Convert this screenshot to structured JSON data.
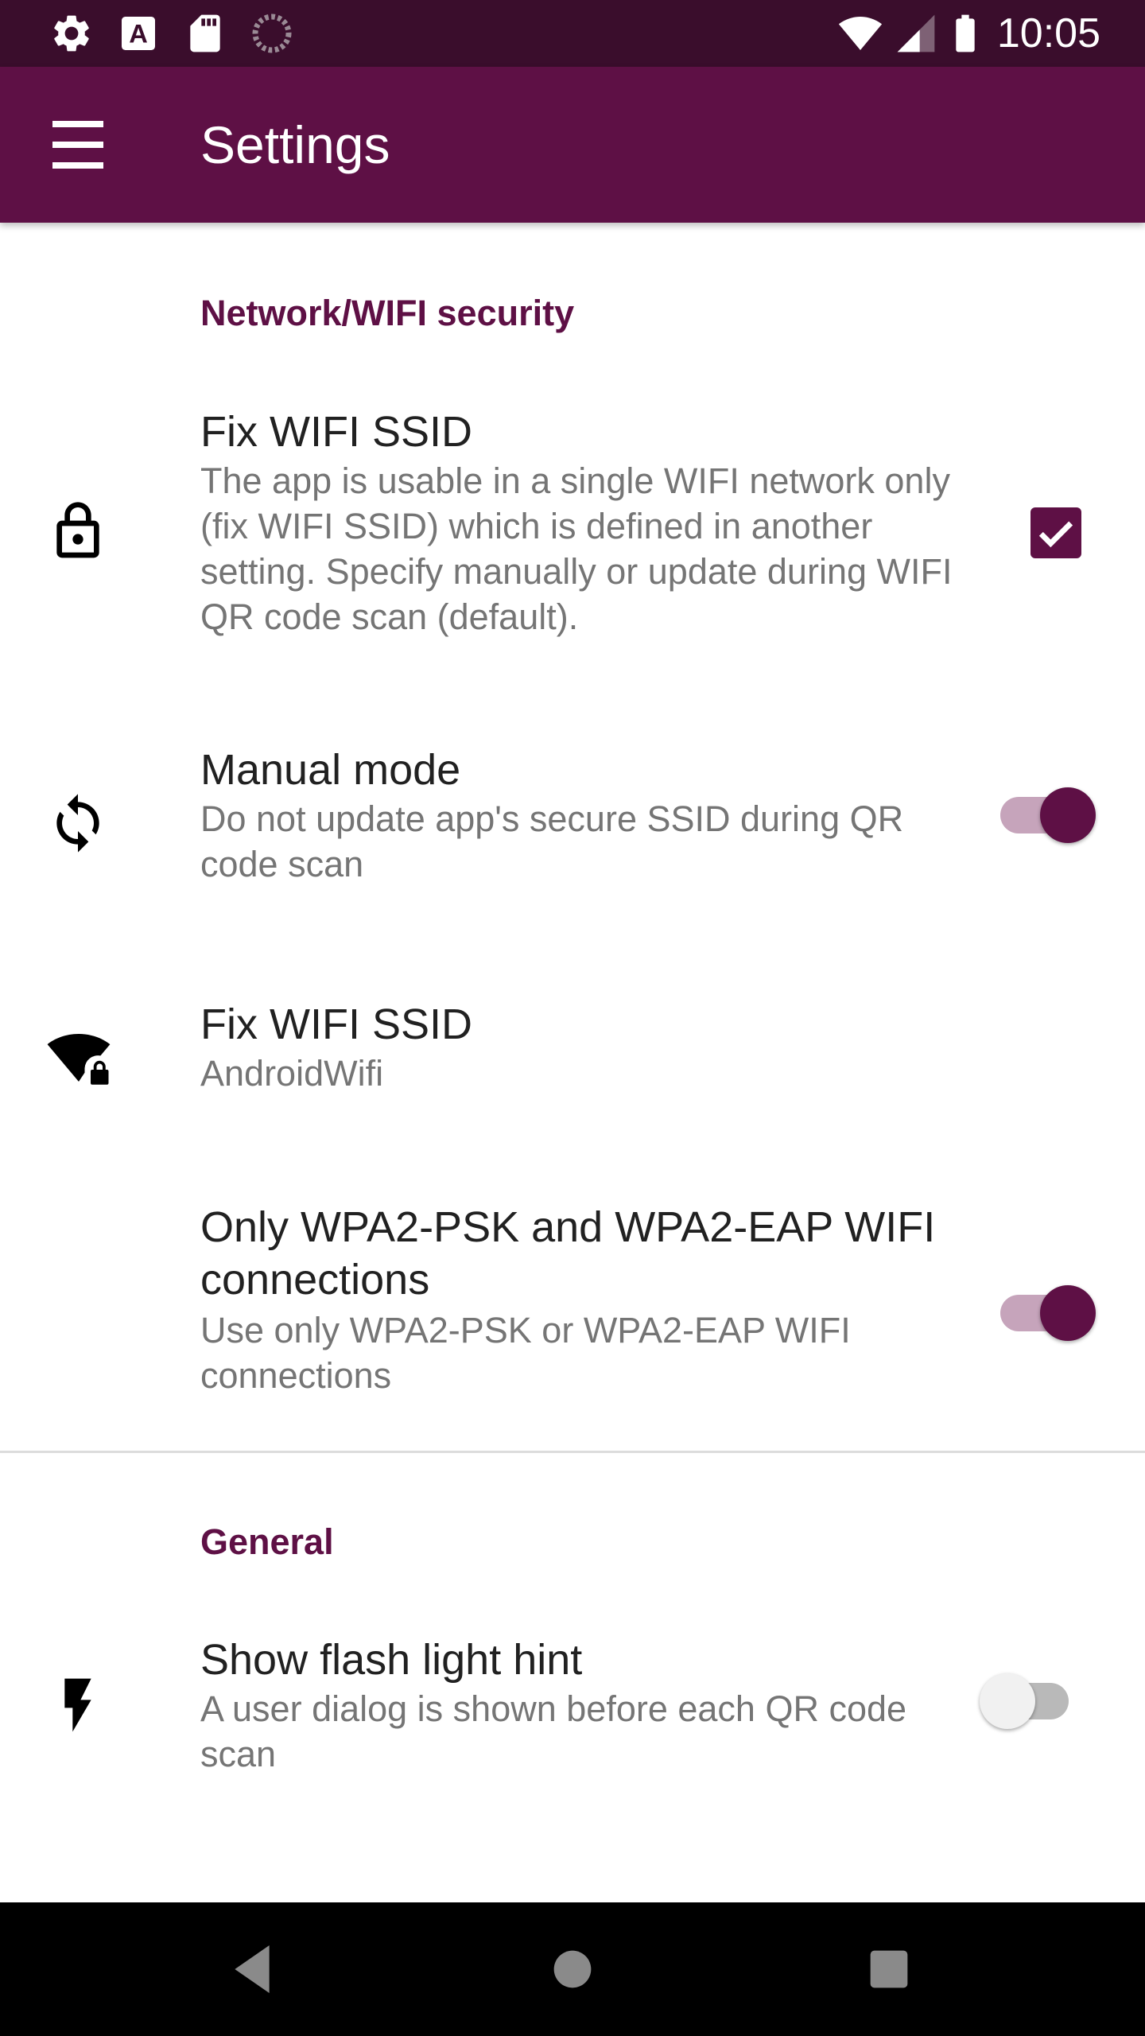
{
  "status_bar": {
    "time": "10:05",
    "icons": [
      "gear-icon",
      "font-icon",
      "sd-card-icon",
      "sync-circle-icon",
      "wifi-signal-icon",
      "cell-signal-icon",
      "battery-icon"
    ]
  },
  "app_bar": {
    "title": "Settings",
    "menu_icon": "hamburger-menu-icon"
  },
  "colors": {
    "primary": "#5e1045",
    "status_bar": "#3a0d2c",
    "accent_track": "#c6a4bb"
  },
  "sections": [
    {
      "header": "Network/WIFI security",
      "items": [
        {
          "title": "Fix WIFI SSID",
          "summary": "The app is usable in a single WIFI network only (fix WIFI SSID) which is defined in another setting. Specify manually or update during WIFI QR code scan (default).",
          "icon": "lock-icon",
          "control": "checkbox",
          "checked": true
        },
        {
          "title": "Manual mode",
          "summary": "Do not update app's secure SSID during QR code scan",
          "icon": "sync-icon",
          "control": "switch",
          "checked": true
        },
        {
          "title": "Fix WIFI SSID",
          "summary": "AndroidWifi",
          "icon": "wifi-lock-icon",
          "control": "none"
        },
        {
          "title": "Only WPA2-PSK and WPA2-EAP WIFI connections",
          "summary": "Use only WPA2-PSK or WPA2-EAP WIFI connections",
          "icon": "",
          "control": "switch",
          "checked": true
        }
      ]
    },
    {
      "header": "General",
      "items": [
        {
          "title": "Show flash light hint",
          "summary": "A user dialog is shown before each QR code scan",
          "icon": "flash-icon",
          "control": "switch",
          "checked": false
        }
      ]
    }
  ],
  "nav_bar": {
    "buttons": [
      "back-icon",
      "home-icon",
      "recents-icon"
    ]
  }
}
